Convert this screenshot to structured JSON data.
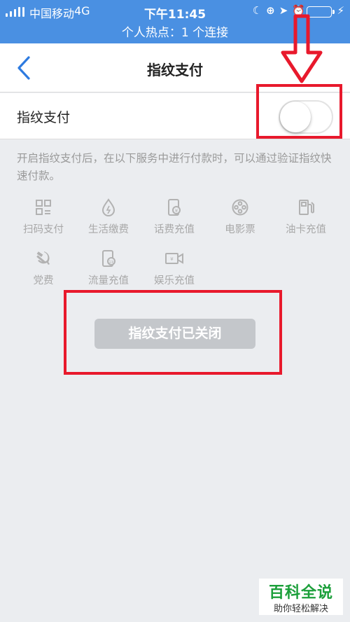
{
  "status_bar": {
    "carrier": "中国移动",
    "network": "4G",
    "time": "下午11:45",
    "icons": [
      "moon-icon",
      "rotation-lock-icon",
      "location-arrow-icon",
      "alarm-icon",
      "battery-icon",
      "charging-bolt-icon"
    ],
    "hotspot": "个人热点：1 个连接",
    "background_color": "#4a90e2"
  },
  "nav": {
    "title": "指纹支付",
    "back_icon": "chevron-left-icon",
    "accent_color": "#2e7be0"
  },
  "toggle": {
    "label": "指纹支付",
    "state": "off"
  },
  "description": "开启指纹支付后，在以下服务中进行付款时，可以通过验证指纹快速付款。",
  "services": [
    {
      "label": "扫码支付",
      "icon": "qr-scan-icon"
    },
    {
      "label": "生活缴费",
      "icon": "water-drop-icon"
    },
    {
      "label": "话费充值",
      "icon": "phone-bill-icon"
    },
    {
      "label": "电影票",
      "icon": "film-reel-icon"
    },
    {
      "label": "油卡充值",
      "icon": "fuel-pump-icon"
    },
    {
      "label": "党费",
      "icon": "hammer-sickle-icon"
    },
    {
      "label": "流量充值",
      "icon": "data-phone-icon"
    },
    {
      "label": "娱乐充值",
      "icon": "video-camera-icon"
    }
  ],
  "status_button": {
    "label": "指纹支付已关闭",
    "background_color": "#c4c7cb"
  },
  "annotations": {
    "color": "#e8192c"
  },
  "watermark": {
    "title": "百科全说",
    "subtitle": "助你轻松解决",
    "color": "#1b9f3a"
  }
}
